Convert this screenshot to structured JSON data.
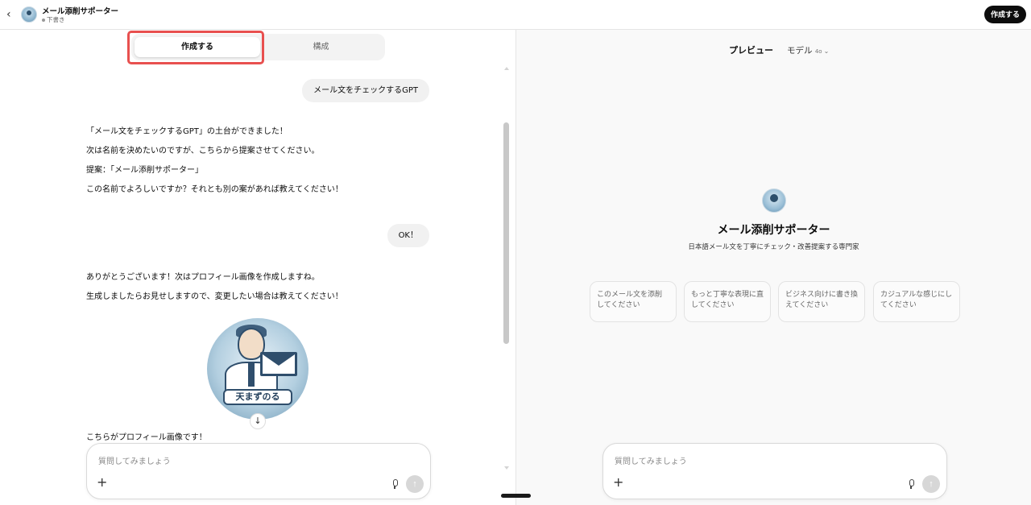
{
  "topbar": {
    "back_label": "‹",
    "title": "メール添削サポーター",
    "status": "下書き",
    "create_button": "作成する"
  },
  "left": {
    "tabs": {
      "create": "作成する",
      "configure": "構成"
    },
    "messages": {
      "user1": "メール文をチェックするGPT",
      "assistant1": [
        "「メール文をチェックするGPT」の土台ができました！",
        "次は名前を決めたいのですが、こちらから提案させてください。",
        "提案：「メール添削サポーター」",
        "この名前でよろしいですか？それとも別の案があれば教えてください！"
      ],
      "user2": "OK！",
      "assistant2": [
        "ありがとうございます！次はプロフィール画像を作成しますね。",
        "生成しましたらお見せしますので、変更したい場合は教えてください！"
      ],
      "image_banner": "天まずのる",
      "assistant3": "こちらがプロフィール画像です！"
    },
    "composer": {
      "placeholder": "質問してみましょう",
      "plus": "+",
      "send": "↑"
    }
  },
  "right": {
    "preview_label": "プレビュー",
    "model_label": "モデル",
    "model_version": "4o",
    "model_chevron": "⌄",
    "gpt_name": "メール添削サポーター",
    "gpt_description": "日本語メール文を丁寧にチェック・改善提案する専門家",
    "starters": [
      "このメール文を添削してください",
      "もっと丁寧な表現に直してください",
      "ビジネス向けに書き換えてください",
      "カジュアルな感じにしてください"
    ],
    "composer": {
      "placeholder": "質問してみましょう",
      "plus": "+",
      "send": "↑"
    }
  },
  "scroll_down_icon": "↓"
}
